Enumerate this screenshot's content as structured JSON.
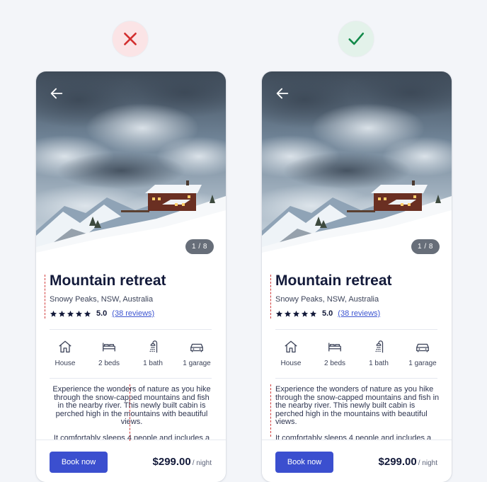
{
  "colors": {
    "accent": "#3b4fcf",
    "bad": "#d32f2f",
    "good": "#138a4a",
    "guide": "#d13a3a"
  },
  "comparison": [
    {
      "verdict": "incorrect",
      "icon": "x-mark-icon"
    },
    {
      "verdict": "correct",
      "icon": "check-mark-icon"
    }
  ],
  "listing": {
    "photo_counter": "1 / 8",
    "title": "Mountain retreat",
    "location": "Snowy Peaks, NSW, Australia",
    "rating": "5.0",
    "stars": 5,
    "reviews": "(38 reviews)",
    "amenities": [
      {
        "icon": "house-icon",
        "label": "House"
      },
      {
        "icon": "bed-icon",
        "label": "2 beds"
      },
      {
        "icon": "shower-icon",
        "label": "1 bath"
      },
      {
        "icon": "car-icon",
        "label": "1 garage"
      }
    ],
    "description": [
      "Experience the wonders of nature as you hike through the snow-capped mountains and fish in the nearby river. This newly built cabin is perched high in the mountains with beautiful views.",
      "It comfortably sleeps 4 people and includes a"
    ],
    "book_label": "Book now",
    "price": "$299.00",
    "price_unit": "/ night"
  }
}
